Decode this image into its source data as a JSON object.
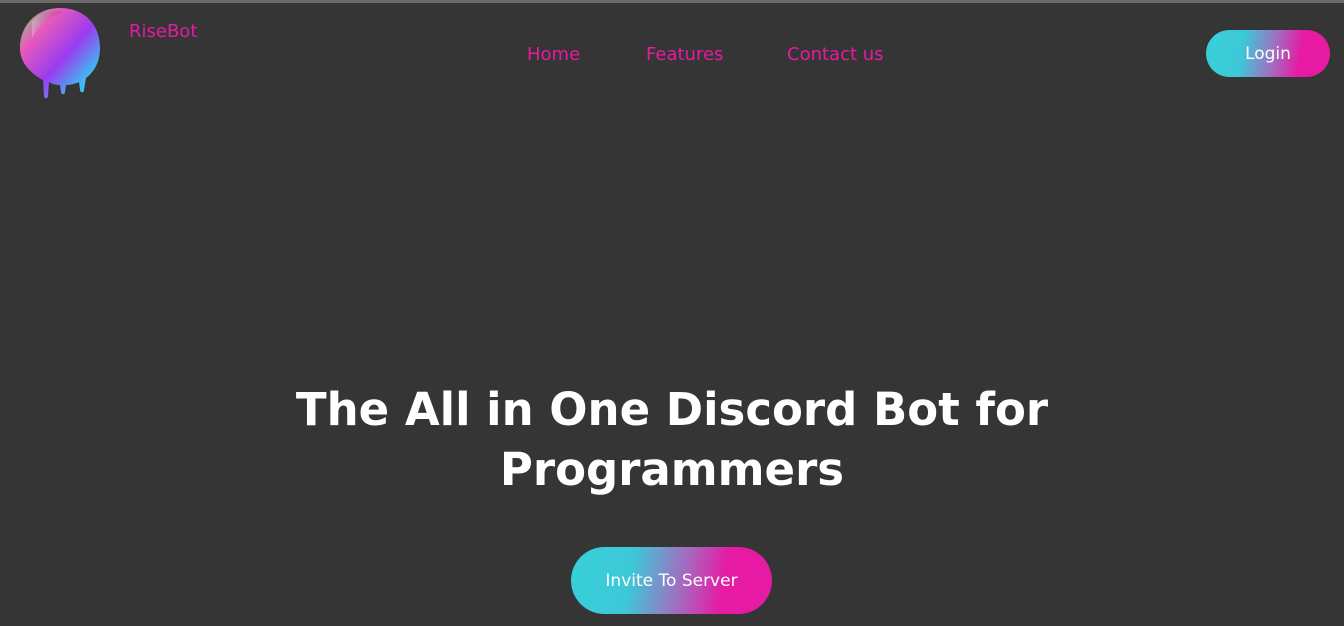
{
  "header": {
    "brand_name": "RiseBot",
    "logo_icon": "paint-blob-logo-icon"
  },
  "nav": {
    "items": [
      {
        "label": "Home"
      },
      {
        "label": "Features"
      },
      {
        "label": "Contact us"
      }
    ]
  },
  "auth": {
    "login_label": "Login"
  },
  "hero": {
    "title_line1": "The All in One Discord Bot for",
    "title_line2": "Programmers",
    "cta_label": "Invite To Server"
  },
  "colors": {
    "background": "#353535",
    "accent_pink": "#e61aa3",
    "accent_cyan": "#37d0d9",
    "text_white": "#ffffff"
  }
}
